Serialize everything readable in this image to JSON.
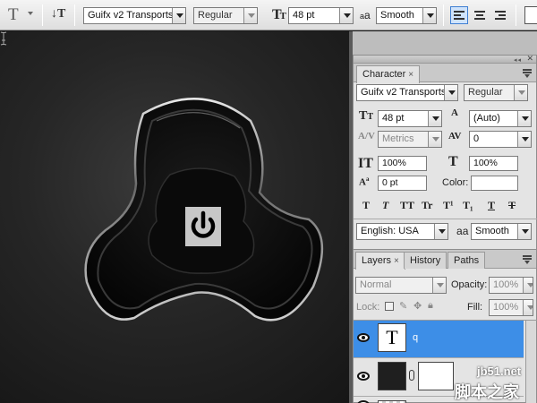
{
  "options_bar": {
    "tool_icon": "T",
    "font_family": "Guifx v2 Transports",
    "font_style": "Regular",
    "font_size": "48 pt",
    "aa_label": "a",
    "aa_label_small": "a",
    "antialias": "Smooth",
    "icons": [
      "text-tool-icon",
      "text-orientation-icon",
      "font-size-icon",
      "antialias-icon",
      "align-left-icon",
      "align-center-icon",
      "align-right-icon"
    ]
  },
  "canvas": {
    "glyph": "power-symbol-glyph"
  },
  "character_panel": {
    "tab_label": "Character",
    "tab_close": "×",
    "font_family": "Guifx v2 Transports",
    "font_style": "Regular",
    "font_size": "48 pt",
    "leading": "(Auto)",
    "kerning": "Metrics",
    "tracking": "0",
    "vertical_scale": "100%",
    "horizontal_scale": "100%",
    "baseline_shift": "0 pt",
    "color_label": "Color:",
    "style_buttons": [
      "T",
      "T",
      "TT",
      "Tr",
      "T¹",
      "T₁",
      "T",
      "T"
    ],
    "language": "English: USA",
    "antialias": "Smooth"
  },
  "layers_panel": {
    "tabs": [
      "Layers",
      "History",
      "Paths"
    ],
    "tab_close": "×",
    "blend_mode": "Normal",
    "opacity_label": "Opacity:",
    "opacity": "100%",
    "lock_label": "Lock:",
    "fill_label": "Fill:",
    "fill": "100%",
    "layers": [
      {
        "thumb": "T",
        "name": "q",
        "selected": true
      },
      {
        "thumb": "",
        "name": "",
        "selected": false
      }
    ]
  },
  "watermark": {
    "site": "jb51.net",
    "name": "脚本之家"
  },
  "colors": {
    "selection": "#3d8ee7",
    "canvas_bg": "#262626",
    "panel_bg": "#e4e4e4"
  }
}
